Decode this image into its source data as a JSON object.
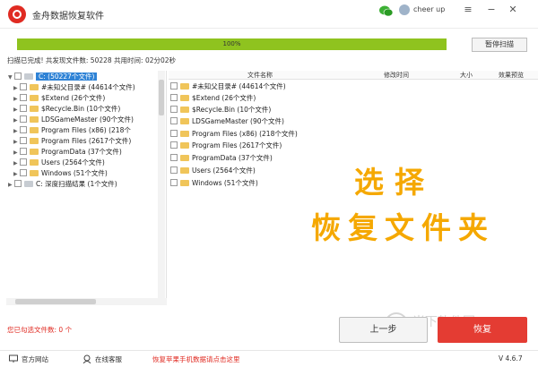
{
  "app": {
    "title": "金舟数据恢复软件",
    "user_name": "cheer up",
    "window_controls": [
      "menu-icon",
      "minimize-icon",
      "close-icon"
    ]
  },
  "progress": {
    "percent": 100,
    "label": "100%",
    "pause_button": "暂停扫描"
  },
  "status_line": "扫描已完成! 共发现文件数: 50228  共用时间: 02分02秒",
  "tree": {
    "root": {
      "label": "C:",
      "count": "(50227个文件)"
    },
    "children": [
      {
        "label": "#未知父目录#",
        "count": "(44614个文件)"
      },
      {
        "label": "$Extend",
        "count": "(26个文件)"
      },
      {
        "label": "$Recycle.Bin",
        "count": "(10个文件)"
      },
      {
        "label": "LDSGameMaster",
        "count": "(90个文件)"
      },
      {
        "label": "Program Files",
        "count": "(x86)  (218个"
      },
      {
        "label": "Program Files",
        "count": "(2617个文件)"
      },
      {
        "label": "ProgramData",
        "count": "(37个文件)"
      },
      {
        "label": "Users",
        "count": "(2564个文件)"
      },
      {
        "label": "Windows",
        "count": "(51个文件)"
      }
    ],
    "deep_scan": {
      "label": "C: 深度扫描结果",
      "count": "(1个文件)"
    }
  },
  "file_list": {
    "columns": [
      "文件名称",
      "修改时间",
      "大小",
      "效果预览"
    ],
    "rows": [
      {
        "name": "#未知父目录#",
        "count": "(44614个文件)"
      },
      {
        "name": "$Extend",
        "count": "(26个文件)"
      },
      {
        "name": "$Recycle.Bin",
        "count": "(10个文件)"
      },
      {
        "name": "LDSGameMaster",
        "count": "(90个文件)"
      },
      {
        "name": "Program Files",
        "count": "(x86)  (218个文件)"
      },
      {
        "name": "Program Files",
        "count": "(2617个文件)"
      },
      {
        "name": "ProgramData",
        "count": "(37个文件)"
      },
      {
        "name": "Users",
        "count": "(2564个文件)"
      },
      {
        "name": "Windows",
        "count": "(51个文件)"
      }
    ]
  },
  "overlay": {
    "line1": "选择",
    "line2": "恢复文件夹"
  },
  "bottom": {
    "selected_count": "您已勾选文件数: 0 个",
    "prev_button": "上一步",
    "recover_button": "恢复"
  },
  "footer": {
    "official_site": "官方网站",
    "online_support": "在线客服",
    "promo": "恢复苹果手机数据请点击这里"
  },
  "watermark": "当下软件园 www.downxia.com",
  "version": "V 4.6.7",
  "colors": {
    "accent_red": "#e43c33",
    "progress_green": "#8fc31f",
    "selection_blue": "#2f83d6",
    "overlay_orange": "#f5a800"
  }
}
